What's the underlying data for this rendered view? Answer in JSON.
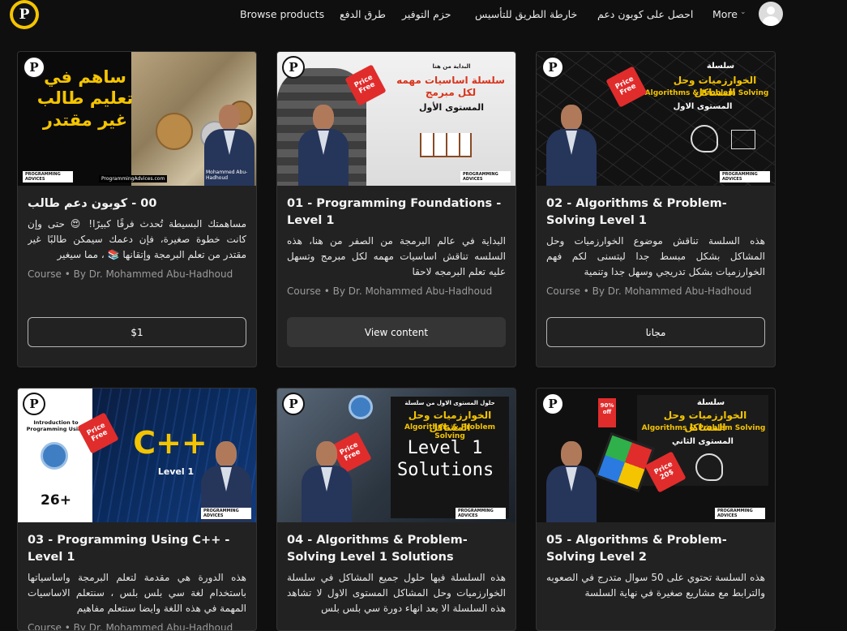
{
  "nav": {
    "logo_letter": "P",
    "browse": "Browse products",
    "payment": "طرق الدفع",
    "bundles": "حزم التوفير",
    "roadmap": "خارطة الطريق للتأسيس",
    "coupon": "احصل على كوبون دعم",
    "more": "More",
    "more_chevron": "⌄"
  },
  "cards": [
    {
      "title": "00 - كوبون دعم طالب",
      "desc": "مساهمتك البسيطة تُحدث فرقًا كبيرًا! 😍 حتى وإن كانت خطوة صغيرة، فإن دعمك سيمكن طالبًا غير مقتدر من تعلم البرمجة وإتقانها 📚 ، مما سيغير",
      "meta": "Course • By Dr. Mohammed Abu-Hadhoud",
      "button": "$1",
      "thumb_text": "ساهم في تعليم طالب غير مقتدر",
      "thumb_site": "ProgrammingAdvices.com",
      "thumb_name": "Mohammed Abu-Hadhoud"
    },
    {
      "title": "01 - Programming Foundations - Level 1",
      "desc": "البداية في عالم البرمجة من الصفر من هنا، هذه السلسه تناقش اساسيات مهمه لكل مبرمج وتسهل عليه تعلم البرمجه لاحقا",
      "meta": "Course • By Dr. Mohammed Abu-Hadhoud",
      "button": "View content",
      "thumb_small": "البداية من هنا",
      "thumb_text": "سلسلة اساسيات مهمه لكل مبرمج",
      "thumb_sub": "المستوى الأول",
      "thumb_tag": "Price Free"
    },
    {
      "title": "02 - Algorithms & Problem-Solving Level 1",
      "desc": "هذه السلسة تناقش موضوع الخوارزميات وحل المشاكل بشكل مبسط جدا ليتسنى لكم فهم الخوارزميات بشكل تدريجي وسهل جدا وتنمية",
      "meta": "Course • By Dr. Mohammed Abu-Hadhoud",
      "button": "مجانا",
      "thumb_small": "سلسلة",
      "thumb_text": "الخوارزميات وحل المشاكل",
      "thumb_en": "Algorithms & Problem Solving",
      "thumb_sub": "المستوى الاول",
      "thumb_tag": "Price Free"
    },
    {
      "title": "03 - Programming Using C++ - Level 1",
      "desc": "هذه الدورة هي مقدمة لتعلم البرمجة واساسياتها باستخدام لغة سي بلس بلس ، سنتعلم الاساسيات المهمة في هذه اللغة وايضا سنتعلم مفاهيم",
      "meta": "Course • By Dr. Mohammed Abu-Hadhoud",
      "thumb_small": "Introduction to Programming Using",
      "thumb_text": "C++",
      "thumb_sub": "Level 1",
      "thumb_years": "26+",
      "thumb_tag": "Price Free"
    },
    {
      "title": "04 - Algorithms & Problem-Solving Level 1 Solutions",
      "desc": "هذه السلسلة فيها حلول جميع المشاكل في سلسلة الخوارزميات وحل المشاكل المستوى الاول لا تشاهد هذه السلسلة الا بعد انهاء دورة سي بلس بلس",
      "thumb_small": "حلول المستوى الاول من سلسلة",
      "thumb_text": "الخوارزميات وحل المشاكل",
      "thumb_en": "Algorithms & Problem Solving",
      "thumb_sub": "Level 1 Solutions",
      "thumb_tag": "Price Free"
    },
    {
      "title": "05 - Algorithms & Problem-Solving Level 2",
      "desc": "هذه السلسة تحتوي على 50 سوال متدرج في الصعوبه والترابط مع مشاريع صغيرة في نهاية السلسة",
      "thumb_small": "سلسلة",
      "thumb_text": "الخوارزميات وحل المشاكل",
      "thumb_en": "Algorithms & Problem Solving",
      "thumb_sub": "المستوى الثاني",
      "thumb_tag": "Price 20$",
      "thumb_off": "90% off"
    }
  ],
  "colors": {
    "accent_yellow": "#f4c400",
    "tag_red": "#e12c2c",
    "card_bg": "#222222",
    "page_bg": "#0f0f0f"
  },
  "icons": [
    "logo-icon",
    "user-avatar-icon",
    "chevron-down-icon"
  ]
}
